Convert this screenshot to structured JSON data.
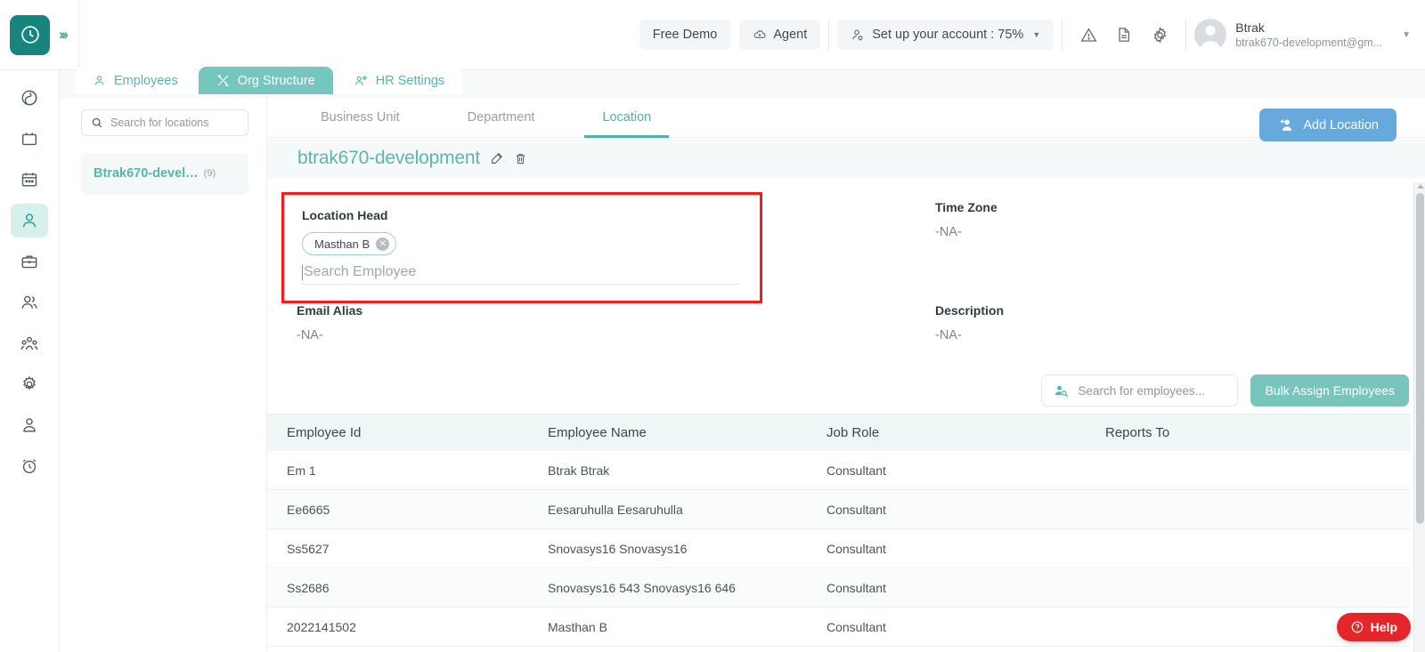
{
  "header": {
    "logo_icon": "clock-logo-icon",
    "expand_icon": "double-chevron-right-icon",
    "free_demo_label": "Free Demo",
    "agent_label": "Agent",
    "setup_label": "Set up your account : 75%",
    "warning_icon": "warning-triangle-icon",
    "document_icon": "document-icon",
    "settings_icon": "gear-icon",
    "user_name": "Btrak",
    "user_email": "btrak670-development@gm...",
    "accent_teal": "#17857e"
  },
  "rail": {
    "items": [
      {
        "icon": "target-spiral-icon",
        "active": false
      },
      {
        "icon": "inbox-tray-icon",
        "active": false
      },
      {
        "icon": "calendar-icon",
        "active": false
      },
      {
        "icon": "person-icon",
        "active": true
      },
      {
        "icon": "briefcase-icon",
        "active": false
      },
      {
        "icon": "people-pair-icon",
        "active": false
      },
      {
        "icon": "org-group-icon",
        "active": false
      },
      {
        "icon": "gear-icon",
        "active": false
      },
      {
        "icon": "user-profile-icon",
        "active": false
      },
      {
        "icon": "alarm-clock-icon",
        "active": false
      }
    ]
  },
  "tabs": [
    {
      "label": "Employees",
      "icon": "person-outline-icon",
      "active": false
    },
    {
      "label": "Org Structure",
      "icon": "tools-icon",
      "active": true
    },
    {
      "label": "HR Settings",
      "icon": "people-gear-icon",
      "active": false
    }
  ],
  "locations_panel": {
    "search_placeholder": "Search for locations",
    "search_value": "",
    "search_icon": "search-icon",
    "items": [
      {
        "name": "Btrak670-devel…",
        "count": "(9)"
      }
    ]
  },
  "subtabs": [
    {
      "label": "Business Unit",
      "active": false
    },
    {
      "label": "Department",
      "active": false
    },
    {
      "label": "Location",
      "active": true
    }
  ],
  "location_detail": {
    "title": "btrak670-development",
    "edit_icon": "edit-pencil-icon",
    "delete_icon": "trash-icon",
    "add_location_label": "Add Location",
    "add_location_icon": "add-person-icon",
    "add_location_color": "#65a9dd",
    "highlight_color": "#f41c1c",
    "fields": {
      "location_head_label": "Location Head",
      "location_head_chip": "Masthan B",
      "location_head_placeholder": "Search Employee",
      "time_zone_label": "Time Zone",
      "time_zone_value": "-NA-",
      "email_alias_label": "Email Alias",
      "email_alias_value": "-NA-",
      "description_label": "Description",
      "description_value": "-NA-"
    }
  },
  "employee_toolbar": {
    "search_placeholder": "Search for employees...",
    "search_value": "",
    "search_icon": "employee-search-icon",
    "bulk_assign_label": "Bulk Assign Employees",
    "bulk_assign_color": "#79c4bc"
  },
  "employee_table": {
    "columns": [
      "Employee Id",
      "Employee Name",
      "Job Role",
      "Reports To"
    ],
    "rows": [
      {
        "id": "Em 1",
        "name": "Btrak Btrak",
        "role": "Consultant",
        "reports_to": ""
      },
      {
        "id": "Ee6665",
        "name": "Eesaruhulla Eesaruhulla",
        "role": "Consultant",
        "reports_to": ""
      },
      {
        "id": "Ss5627",
        "name": "Snovasys16 Snovasys16",
        "role": "Consultant",
        "reports_to": ""
      },
      {
        "id": "Ss2686",
        "name": "Snovasys16 543 Snovasys16 646",
        "role": "Consultant",
        "reports_to": ""
      },
      {
        "id": "2022141502",
        "name": "Masthan B",
        "role": "Consultant",
        "reports_to": ""
      }
    ]
  },
  "help_widget": {
    "label": "Help",
    "icon": "question-circle-icon",
    "color": "#e5252a"
  }
}
